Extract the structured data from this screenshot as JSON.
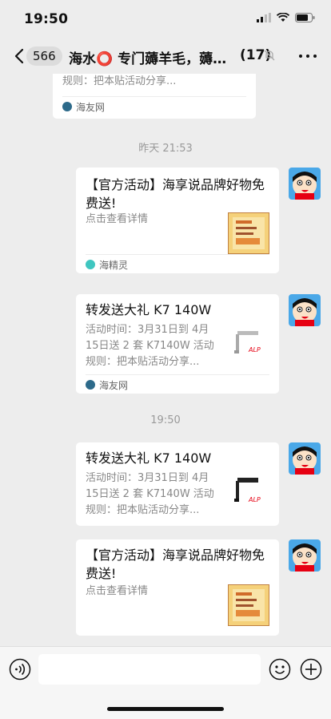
{
  "status": {
    "time": "19:50"
  },
  "nav": {
    "unread": "566",
    "title": "海水⭕ 专门薅羊毛，薅…",
    "count": "(17)"
  },
  "messages": {
    "partial": {
      "line1": "规则：把本贴活动分享...",
      "source": "海友网"
    },
    "ts1": "昨天 21:53",
    "m1": {
      "title": "【官方活动】海享说品牌好物免费送!",
      "desc": "点击查看详情",
      "source": "海精灵"
    },
    "m2": {
      "title": "转发送大礼 K7 140W",
      "desc": "活动时间：3月31日到 4月15日送 2 套 K7140W 活动规则：把本贴活动分享...",
      "source": "海友网"
    },
    "ts2": "19:50",
    "m3": {
      "title": "转发送大礼 K7 140W",
      "desc": "活动时间：3月31日到 4月15日送 2 套 K7140W 活动规则：把本贴活动分享..."
    },
    "m4": {
      "title": "【官方活动】海享说品牌好物免费送!",
      "desc": "点击查看详情"
    }
  },
  "colors": {
    "background": "#ededed",
    "card": "#ffffff",
    "muted": "#888888",
    "accent_red": "#e60012"
  },
  "icons": [
    "signal-icon",
    "wifi-icon",
    "battery-icon",
    "back-icon",
    "mute-icon",
    "more-icon",
    "voice-icon",
    "emoji-icon",
    "plus-icon"
  ]
}
